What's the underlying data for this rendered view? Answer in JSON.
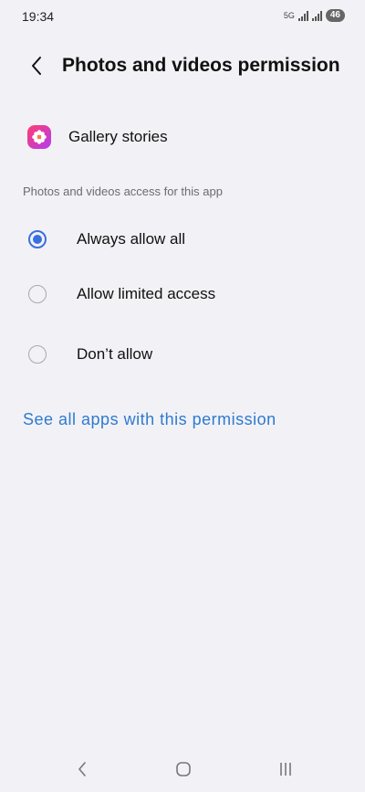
{
  "status_bar": {
    "time": "19:34",
    "network_label": "5G",
    "battery_level": "46"
  },
  "header": {
    "title": "Photos and videos permission",
    "back_icon": "chevron-left-icon"
  },
  "app": {
    "name": "Gallery stories",
    "icon": "flower-app-icon"
  },
  "section": {
    "label": "Photos and videos access for this app"
  },
  "options": [
    {
      "label": "Always allow all",
      "selected": true
    },
    {
      "label": "Allow limited access",
      "selected": false
    },
    {
      "label": "Don’t allow",
      "selected": false
    }
  ],
  "link": {
    "label": "See all apps with this permission"
  },
  "navbar": {
    "back_icon": "nav-back-icon",
    "home_icon": "nav-home-icon",
    "recents_icon": "nav-recents-icon"
  },
  "colors": {
    "background": "#f2f2f6",
    "accent": "#3b6fe0",
    "link": "#2f7ad0"
  }
}
